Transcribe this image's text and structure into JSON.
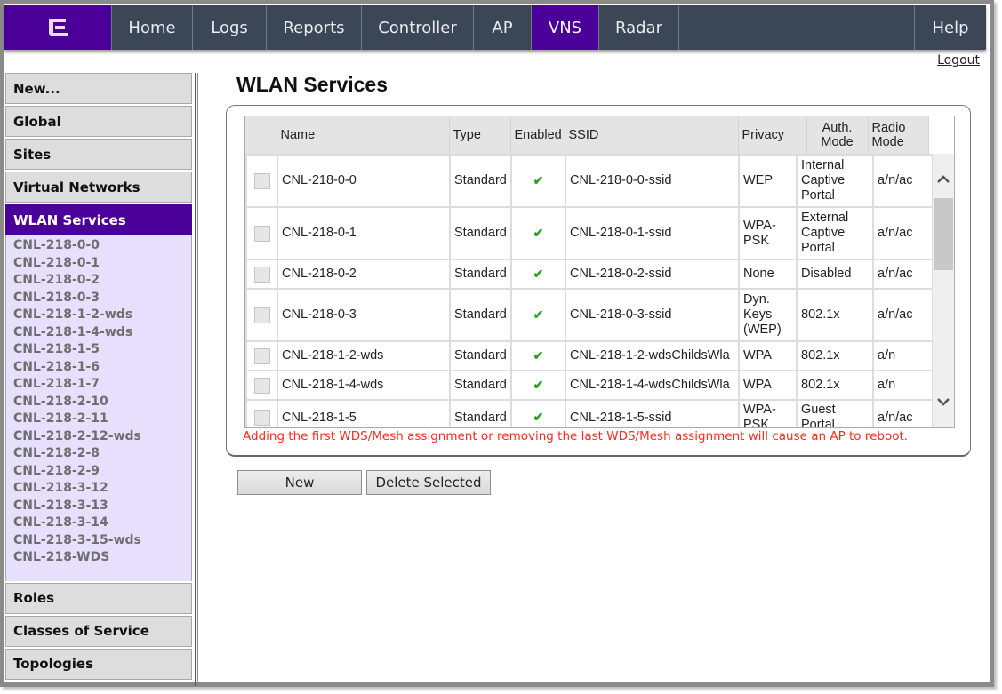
{
  "nav": {
    "logo": "extreme-logo",
    "items": [
      {
        "label": "Home",
        "active": false
      },
      {
        "label": "Logs",
        "active": false
      },
      {
        "label": "Reports",
        "active": false
      },
      {
        "label": "Controller",
        "active": false
      },
      {
        "label": "AP",
        "active": false
      },
      {
        "label": "VNS",
        "active": true
      },
      {
        "label": "Radar",
        "active": false
      }
    ],
    "help": "Help",
    "logout": "Logout",
    "accent_color": "#4a0099",
    "bar_color": "#3b4656"
  },
  "sidebar": {
    "top_items": [
      "New...",
      "Global",
      "Sites",
      "Virtual Networks"
    ],
    "active_item": "WLAN Services",
    "sub_items": [
      "CNL-218-0-0",
      "CNL-218-0-1",
      "CNL-218-0-2",
      "CNL-218-0-3",
      "CNL-218-1-2-wds",
      "CNL-218-1-4-wds",
      "CNL-218-1-5",
      "CNL-218-1-6",
      "CNL-218-1-7",
      "CNL-218-2-10",
      "CNL-218-2-11",
      "CNL-218-2-12-wds",
      "CNL-218-2-8",
      "CNL-218-2-9",
      "CNL-218-3-12",
      "CNL-218-3-13",
      "CNL-218-3-14",
      "CNL-218-3-15-wds",
      "CNL-218-WDS"
    ],
    "bottom_items": [
      "Roles",
      "Classes of Service",
      "Topologies"
    ]
  },
  "main": {
    "title": "WLAN Services",
    "table": {
      "columns": [
        "",
        "Name",
        "Type",
        "Enabled",
        "SSID",
        "Privacy",
        "Auth. Mode",
        "Radio Mode"
      ],
      "rows": [
        {
          "name": "CNL-218-0-0",
          "type": "Standard",
          "enabled": true,
          "ssid": "CNL-218-0-0-ssid",
          "privacy": "WEP",
          "auth": "Internal Captive Portal",
          "radio": "a/n/ac"
        },
        {
          "name": "CNL-218-0-1",
          "type": "Standard",
          "enabled": true,
          "ssid": "CNL-218-0-1-ssid",
          "privacy": "WPA-PSK",
          "auth": "External Captive Portal",
          "radio": "a/n/ac"
        },
        {
          "name": "CNL-218-0-2",
          "type": "Standard",
          "enabled": true,
          "ssid": "CNL-218-0-2-ssid",
          "privacy": "None",
          "auth": "Disabled",
          "radio": "a/n/ac"
        },
        {
          "name": "CNL-218-0-3",
          "type": "Standard",
          "enabled": true,
          "ssid": "CNL-218-0-3-ssid",
          "privacy": "Dyn. Keys (WEP)",
          "auth": "802.1x",
          "radio": "a/n/ac"
        },
        {
          "name": "CNL-218-1-2-wds",
          "type": "Standard",
          "enabled": true,
          "ssid": "CNL-218-1-2-wdsChildsWla",
          "privacy": "WPA",
          "auth": "802.1x",
          "radio": "a/n"
        },
        {
          "name": "CNL-218-1-4-wds",
          "type": "Standard",
          "enabled": true,
          "ssid": "CNL-218-1-4-wdsChildsWla",
          "privacy": "WPA",
          "auth": "802.1x",
          "radio": "a/n"
        },
        {
          "name": "CNL-218-1-5",
          "type": "Standard",
          "enabled": true,
          "ssid": "CNL-218-1-5-ssid",
          "privacy": "WPA-PSK",
          "auth": "Guest Portal",
          "radio": "a/n/ac"
        }
      ],
      "enabled_glyph": "✔"
    },
    "warning": "Adding the first WDS/Mesh assignment or removing the last WDS/Mesh assignment will cause an AP to reboot.",
    "buttons": {
      "new": "New",
      "delete": "Delete Selected"
    }
  }
}
